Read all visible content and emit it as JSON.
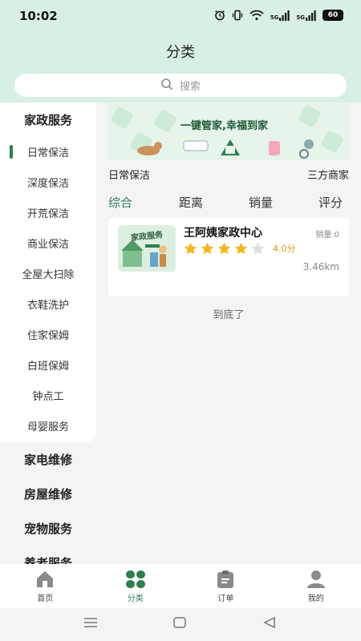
{
  "status_bar": {
    "time": "10:02",
    "network_label_1": "5G",
    "network_label_2": "5G",
    "battery": "60"
  },
  "header": {
    "title": "分类",
    "search_placeholder": "搜索"
  },
  "sidebar": {
    "active_category": "家政服务",
    "sub_items": [
      "日常保洁",
      "深度保洁",
      "开荒保洁",
      "商业保洁",
      "全屋大扫除",
      "衣鞋洗护",
      "住家保姆",
      "白班保姆",
      "钟点工",
      "母婴服务"
    ],
    "other_categories": [
      "家电维修",
      "房屋维修",
      "宠物服务",
      "养老服务"
    ]
  },
  "main": {
    "banner_text": "一键管家,幸福到家",
    "current_category": "日常保洁",
    "third_party_label": "三方商家",
    "sort_tabs": [
      "综合",
      "距离",
      "销量",
      "评分"
    ],
    "active_sort": "综合",
    "stores": [
      {
        "name": "王阿姨家政中心",
        "sales_label": "销量:0",
        "rating": 4.0,
        "rating_label": "4.0分",
        "distance": "3.46km",
        "thumb_text": "家政服务"
      }
    ],
    "end_text": "到底了"
  },
  "tab_bar": {
    "tabs": [
      "首页",
      "分类",
      "订单",
      "我的"
    ],
    "active": "分类"
  },
  "colors": {
    "accent": "#2e7d4f",
    "header_bg": "#d8f0e3",
    "star": "#f2b51c",
    "star_empty": "#dddddd"
  }
}
